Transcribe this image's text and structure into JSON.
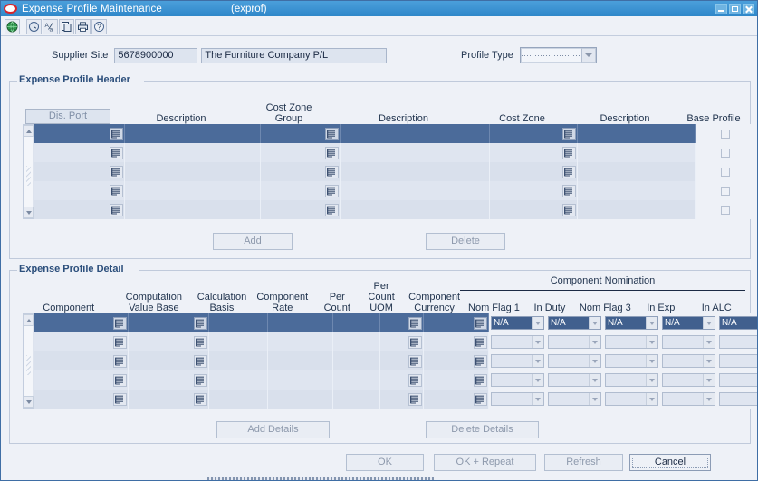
{
  "window": {
    "title": "Expense Profile Maintenance",
    "code": "(exprof)",
    "logo_icon": "oracle-logo",
    "controls": [
      {
        "name": "minimize-button",
        "icon": "minimize-icon"
      },
      {
        "name": "maximize-button",
        "icon": "maximize-icon"
      },
      {
        "name": "close-button",
        "icon": "close-icon"
      }
    ]
  },
  "toolbar": {
    "buttons": [
      {
        "name": "globe-button",
        "icon": "globe-icon"
      },
      {
        "name": "clock-button",
        "icon": "clock-icon"
      },
      {
        "name": "translate-button",
        "icon": "translate-icon"
      },
      {
        "name": "copy-button",
        "icon": "copy-icon"
      },
      {
        "name": "print-button",
        "icon": "print-icon"
      },
      {
        "name": "help-button",
        "icon": "help-icon"
      }
    ]
  },
  "form": {
    "supplier_site_label": "Supplier Site",
    "supplier_site_id": "5678900000",
    "supplier_site_name": "The Furniture Company P/L",
    "profile_type_label": "Profile Type",
    "profile_type_value": "",
    "profile_type_options": []
  },
  "header_section": {
    "title": "Expense Profile Header",
    "columns": [
      {
        "label": "Dis. Port",
        "is_button": true
      },
      {
        "label": "Description"
      },
      {
        "label": "Cost Zone\nGroup",
        "line1": "Cost Zone",
        "line2": "Group"
      },
      {
        "label": "Description"
      },
      {
        "label": "Cost Zone"
      },
      {
        "label": "Description"
      },
      {
        "label": "Base Profile"
      }
    ],
    "rows": [
      {
        "selected": true,
        "dis_port": "",
        "description1": "",
        "cost_zone_group": "",
        "description2": "",
        "cost_zone": "",
        "description3": "",
        "base_profile": false
      },
      {
        "selected": false,
        "dis_port": "",
        "description1": "",
        "cost_zone_group": "",
        "description2": "",
        "cost_zone": "",
        "description3": "",
        "base_profile": false
      },
      {
        "selected": false,
        "dis_port": "",
        "description1": "",
        "cost_zone_group": "",
        "description2": "",
        "cost_zone": "",
        "description3": "",
        "base_profile": false
      },
      {
        "selected": false,
        "dis_port": "",
        "description1": "",
        "cost_zone_group": "",
        "description2": "",
        "cost_zone": "",
        "description3": "",
        "base_profile": false
      },
      {
        "selected": false,
        "dis_port": "",
        "description1": "",
        "cost_zone_group": "",
        "description2": "",
        "cost_zone": "",
        "description3": "",
        "base_profile": false
      }
    ],
    "add_label": "Add",
    "add_enabled": false,
    "delete_label": "Delete",
    "delete_enabled": false
  },
  "detail_section": {
    "title": "Expense Profile Detail",
    "columns": [
      {
        "label": "Component"
      },
      {
        "label": "Computation Value Base",
        "line1": "Computation",
        "line2": "Value Base"
      },
      {
        "label": "Calculation Basis",
        "line1": "Calculation",
        "line2": "Basis"
      },
      {
        "label": "Component Rate",
        "line1": "Component",
        "line2": "Rate"
      },
      {
        "label": "Per Count",
        "line1": "Per",
        "line2": "Count"
      },
      {
        "label": "Per Count UOM",
        "line0": "Per",
        "line1": "Count",
        "line2": "UOM"
      },
      {
        "label": "Component Currency",
        "line1": "Component",
        "line2": "Currency"
      }
    ],
    "nomination_group_label": "Component Nomination",
    "nomination_columns": [
      "Nom Flag 1",
      "In Duty",
      "Nom Flag 3",
      "In Exp",
      "In ALC"
    ],
    "rows": [
      {
        "selected": true,
        "component": "",
        "computation_value_base": "",
        "calculation_basis": "",
        "component_rate": "",
        "per_count": "",
        "per_count_uom": "",
        "component_currency": "",
        "nominations": [
          "N/A",
          "N/A",
          "N/A",
          "N/A",
          "N/A"
        ]
      },
      {
        "selected": false,
        "component": "",
        "computation_value_base": "",
        "calculation_basis": "",
        "component_rate": "",
        "per_count": "",
        "per_count_uom": "",
        "component_currency": "",
        "nominations": [
          "",
          "",
          "",
          "",
          ""
        ]
      },
      {
        "selected": false,
        "component": "",
        "computation_value_base": "",
        "calculation_basis": "",
        "component_rate": "",
        "per_count": "",
        "per_count_uom": "",
        "component_currency": "",
        "nominations": [
          "",
          "",
          "",
          "",
          ""
        ]
      },
      {
        "selected": false,
        "component": "",
        "computation_value_base": "",
        "calculation_basis": "",
        "component_rate": "",
        "per_count": "",
        "per_count_uom": "",
        "component_currency": "",
        "nominations": [
          "",
          "",
          "",
          "",
          ""
        ]
      },
      {
        "selected": false,
        "component": "",
        "computation_value_base": "",
        "calculation_basis": "",
        "component_rate": "",
        "per_count": "",
        "per_count_uom": "",
        "component_currency": "",
        "nominations": [
          "",
          "",
          "",
          "",
          ""
        ]
      }
    ],
    "add_details_label": "Add Details",
    "add_details_enabled": false,
    "delete_details_label": "Delete Details",
    "delete_details_enabled": false
  },
  "footer": {
    "buttons": [
      {
        "name": "ok-button",
        "label": "OK",
        "enabled": false,
        "accel_index": -1
      },
      {
        "name": "ok-repeat-button",
        "label": "OK + Repeat",
        "enabled": false
      },
      {
        "name": "refresh-button",
        "label": "Refresh",
        "enabled": false
      },
      {
        "name": "cancel-button",
        "label": "Cancel",
        "enabled": true
      }
    ]
  },
  "colors": {
    "titlebar": "#3a93d4",
    "selection": "#4b6b9a",
    "group_title": "#2c4f7c",
    "background": "#eef1f7",
    "row_even": "#d9e0ec",
    "row_odd": "#dfe5f0"
  }
}
